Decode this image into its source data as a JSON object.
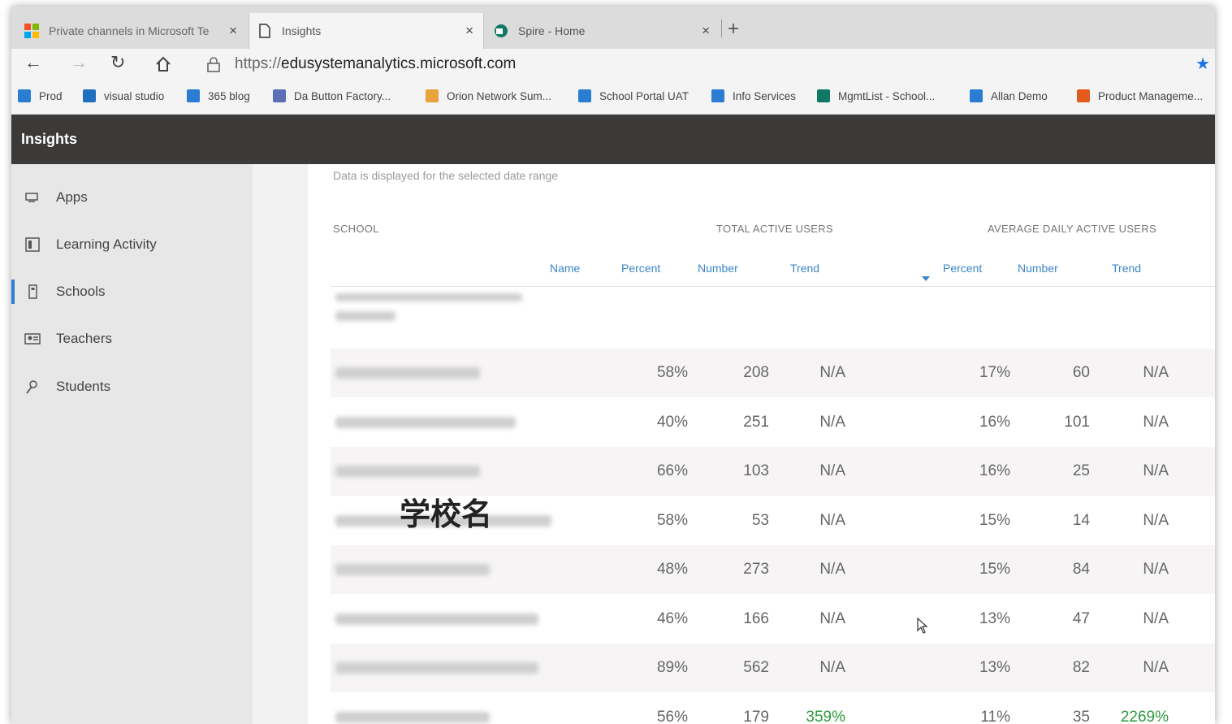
{
  "browser": {
    "tabs": [
      {
        "title": "Private channels in Microsoft Te",
        "active": false
      },
      {
        "title": "Insights",
        "active": true
      },
      {
        "title": "Spire - Home",
        "active": false
      }
    ],
    "new_tab_glyph": "+",
    "close_glyph": "×",
    "url_protocol": "https://",
    "url_host": "edusystemanalytics.microsoft.com",
    "nav_icons": [
      "back-arrow-icon",
      "forward-arrow-icon",
      "refresh-icon",
      "home-icon",
      "lock-icon",
      "favorite-star-icon"
    ],
    "bookmarks": [
      {
        "label": "Prod",
        "color": "#2b7cd3"
      },
      {
        "label": "visual studio",
        "color": "#1f6fc0"
      },
      {
        "label": "365 blog",
        "color": "#2b7cd3"
      },
      {
        "label": "Da Button Factory...",
        "color": "#5a6fb5"
      },
      {
        "label": "Orion Network Sum...",
        "color": "#e8a33d"
      },
      {
        "label": "School Portal UAT",
        "color": "#2b7cd3"
      },
      {
        "label": "Info Services",
        "color": "#2b7cd3"
      },
      {
        "label": "MgmtList - School...",
        "color": "#117865"
      },
      {
        "label": "Allan Demo",
        "color": "#2b7cd3"
      },
      {
        "label": "Product Manageme...",
        "color": "#e25b1b"
      }
    ]
  },
  "app": {
    "title": "Insights",
    "sidebar": [
      {
        "label": "Apps",
        "icon": "apps-icon",
        "active": false
      },
      {
        "label": "Learning Activity",
        "icon": "learning-activity-icon",
        "active": false
      },
      {
        "label": "Schools",
        "icon": "schools-icon",
        "active": true
      },
      {
        "label": "Teachers",
        "icon": "teachers-icon",
        "active": false
      },
      {
        "label": "Students",
        "icon": "students-icon",
        "active": false
      }
    ],
    "accent_color": "#2f7dd1",
    "trend_positive_color": "#2d9a3b"
  },
  "table": {
    "note": "Data is displayed for the selected date range",
    "group_school": "SCHOOL",
    "group_total": "TOTAL ACTIVE USERS",
    "group_avg": "AVERAGE DAILY ACTIVE USERS",
    "columns": [
      "Name",
      "Percent",
      "Number",
      "Trend",
      "Percent",
      "Number",
      "Trend"
    ],
    "overlay_label": "学校名",
    "rows": [
      {
        "total_pct": "58%",
        "total_num": "208",
        "total_trend": "N/A",
        "avg_pct": "17%",
        "avg_num": "60",
        "avg_trend": "N/A"
      },
      {
        "total_pct": "40%",
        "total_num": "251",
        "total_trend": "N/A",
        "avg_pct": "16%",
        "avg_num": "101",
        "avg_trend": "N/A"
      },
      {
        "total_pct": "66%",
        "total_num": "103",
        "total_trend": "N/A",
        "avg_pct": "16%",
        "avg_num": "25",
        "avg_trend": "N/A"
      },
      {
        "total_pct": "58%",
        "total_num": "53",
        "total_trend": "N/A",
        "avg_pct": "15%",
        "avg_num": "14",
        "avg_trend": "N/A"
      },
      {
        "total_pct": "48%",
        "total_num": "273",
        "total_trend": "N/A",
        "avg_pct": "15%",
        "avg_num": "84",
        "avg_trend": "N/A"
      },
      {
        "total_pct": "46%",
        "total_num": "166",
        "total_trend": "N/A",
        "avg_pct": "13%",
        "avg_num": "47",
        "avg_trend": "N/A"
      },
      {
        "total_pct": "89%",
        "total_num": "562",
        "total_trend": "N/A",
        "avg_pct": "13%",
        "avg_num": "82",
        "avg_trend": "N/A"
      },
      {
        "total_pct": "56%",
        "total_num": "179",
        "total_trend": "359%",
        "avg_pct": "11%",
        "avg_num": "35",
        "avg_trend": "2269%"
      }
    ]
  }
}
